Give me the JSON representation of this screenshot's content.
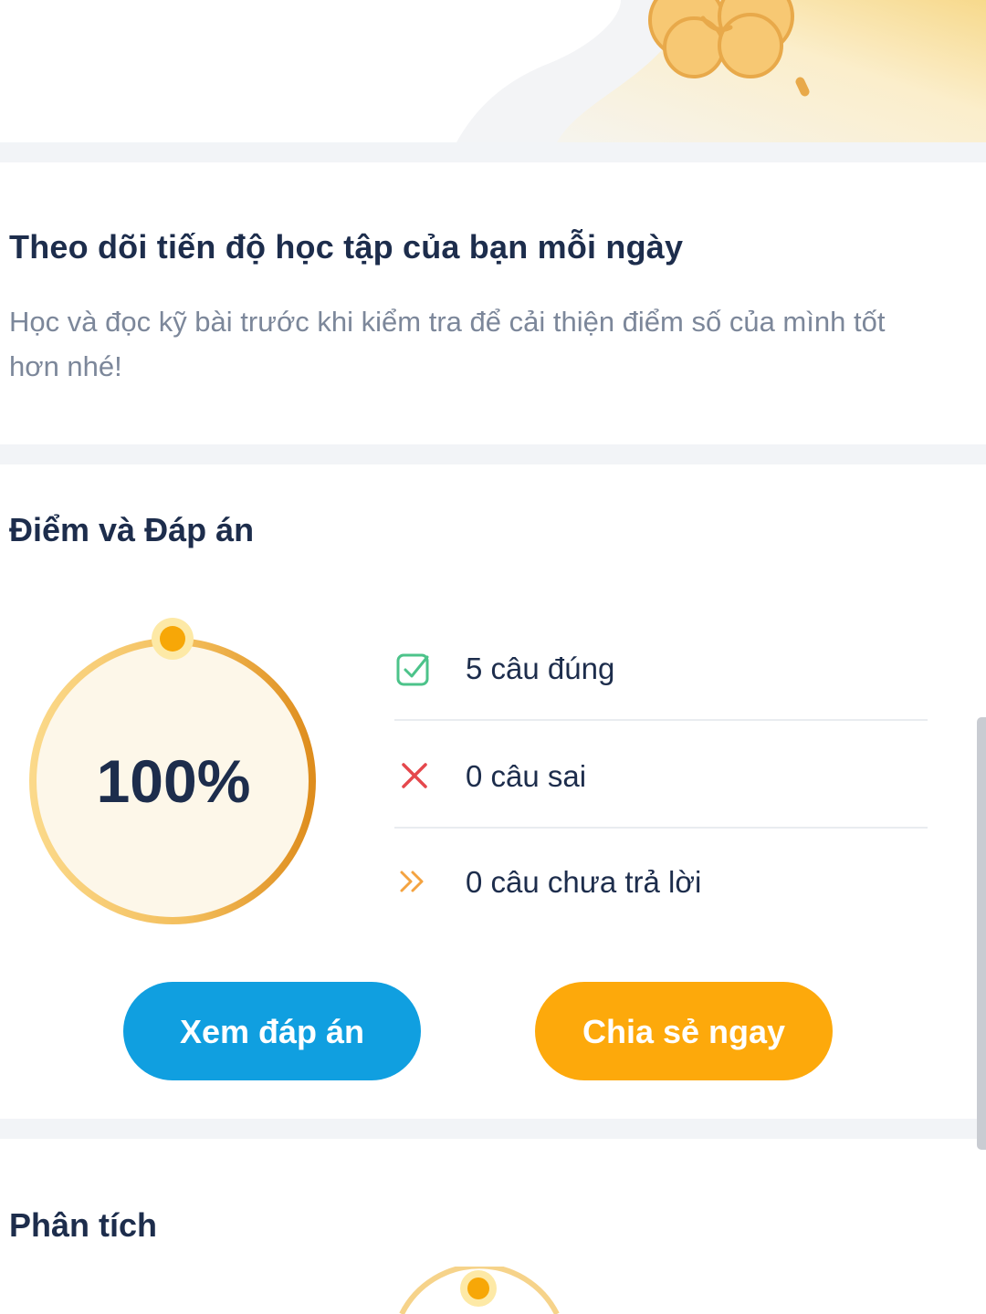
{
  "progress_section": {
    "title": "Theo dõi tiến độ học tập của bạn mỗi ngày",
    "description": "Học và đọc kỹ bài trước khi kiểm tra để cải thiện điểm số của mình tốt hơn nhé!"
  },
  "score_section": {
    "title": "Điểm và Đáp án",
    "score_percent": "100%",
    "score_fraction": 1.0,
    "stats": [
      {
        "label": "5 câu đúng",
        "icon": "check-square-icon",
        "color": "#4cc38a"
      },
      {
        "label": "0 câu sai",
        "icon": "close-icon",
        "color": "#e5484d"
      },
      {
        "label": "0 câu chưa trả lời",
        "icon": "double-chevron-right-icon",
        "color": "#f4a340"
      }
    ],
    "buttons": {
      "view_answers": "Xem đáp án",
      "share_now": "Chia sẻ ngay"
    }
  },
  "analysis_section": {
    "title": "Phân tích"
  },
  "colors": {
    "primary_blue": "#109fe0",
    "primary_orange": "#fda90b",
    "heading": "#1d2d4c",
    "muted": "#7c879a"
  }
}
